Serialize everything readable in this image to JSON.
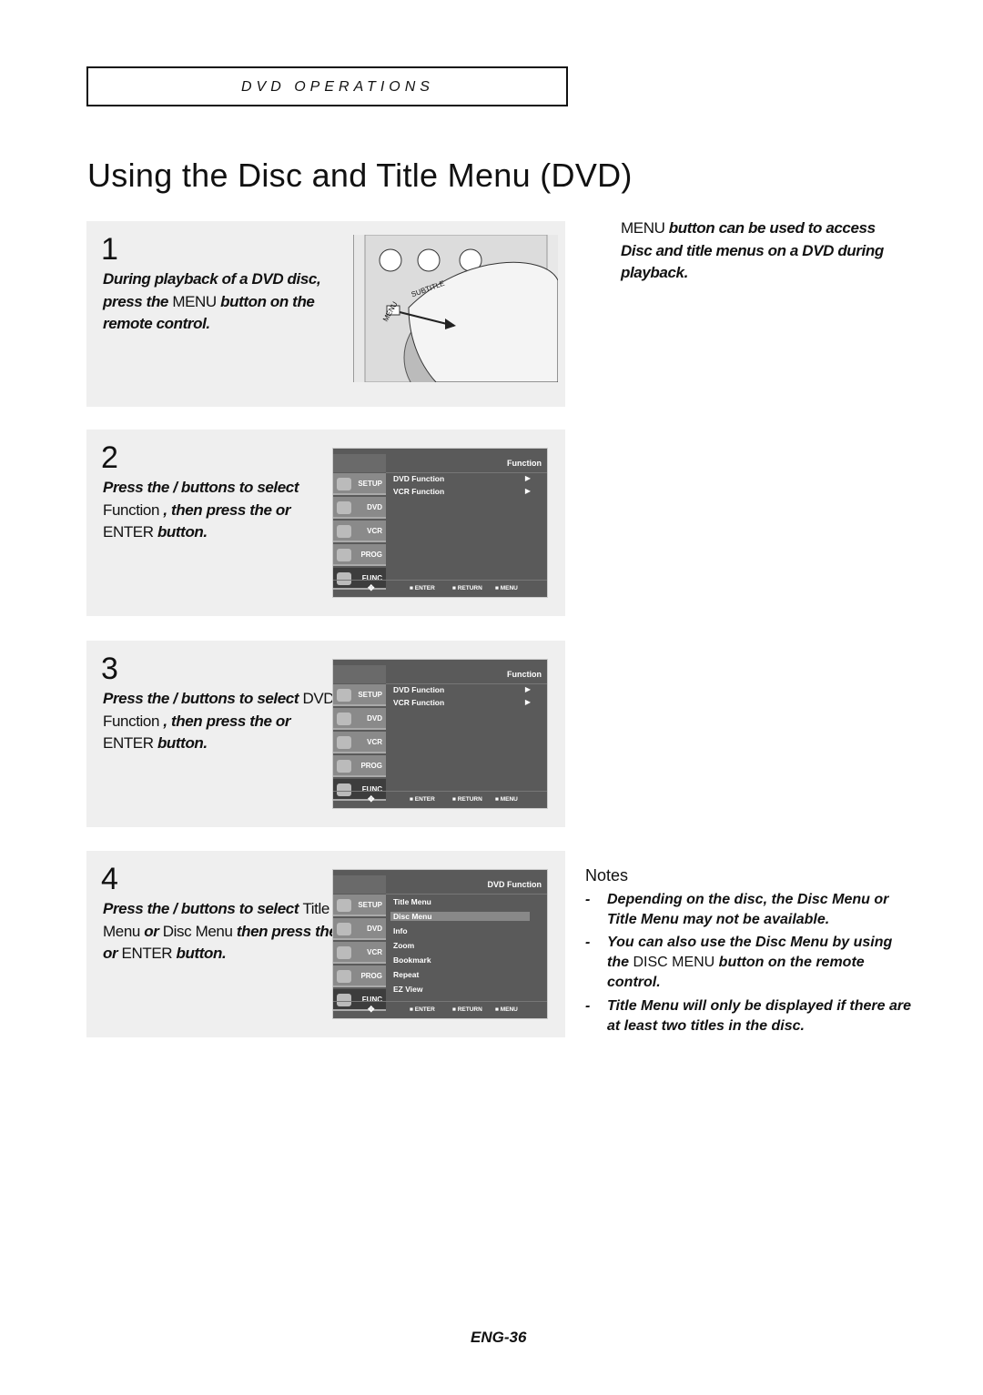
{
  "section": "DVD OPERATIONS",
  "title": "Using the Disc and Title Menu (DVD)",
  "intro": {
    "menu": "MENU",
    "rest1": " button can be used to access",
    "line2": "Disc and title menus on a DVD during",
    "line3": "playback."
  },
  "steps": [
    {
      "num": "1",
      "parts": [
        [
          "b",
          "During playback of a DVD disc, press the "
        ],
        [
          "n",
          "MENU"
        ],
        [
          "b",
          " button on the remote control."
        ]
      ]
    },
    {
      "num": "2",
      "parts": [
        [
          "b",
          "Press the    /    buttons to select "
        ],
        [
          "n",
          "Function"
        ],
        [
          "b",
          " , then press the     or "
        ],
        [
          "n",
          "ENTER"
        ],
        [
          "b",
          " button."
        ]
      ]
    },
    {
      "num": "3",
      "parts": [
        [
          "b",
          "Press the    /    buttons to select "
        ],
        [
          "n",
          "DVD Function"
        ],
        [
          "b",
          " , then press the     or "
        ],
        [
          "n",
          "ENTER"
        ],
        [
          "b",
          " button."
        ]
      ]
    },
    {
      "num": "4",
      "parts": [
        [
          "b",
          "Press the    /    buttons to select "
        ],
        [
          "n",
          "Title Menu"
        ],
        [
          "b",
          " or "
        ],
        [
          "n",
          "Disc Menu"
        ],
        [
          "b",
          " then press the     or "
        ],
        [
          "n",
          "ENTER"
        ],
        [
          "b",
          " button."
        ]
      ]
    }
  ],
  "remote": {
    "labels": [
      "SUBTITLE",
      "MENU"
    ]
  },
  "screens": [
    {
      "header": "Function",
      "items": [
        "DVD Function",
        "VCR Function"
      ],
      "arrows": true,
      "selected": -1
    },
    {
      "header": "Function",
      "items": [
        "DVD Function",
        "VCR Function"
      ],
      "arrows": true,
      "selected": -1
    },
    {
      "header": "DVD Function",
      "items": [
        "Title Menu",
        "Disc Menu",
        "Info",
        "Zoom",
        "Bookmark",
        "Repeat",
        "EZ View"
      ],
      "arrows": false,
      "selected": 1
    }
  ],
  "screen_side": [
    "SETUP",
    "DVD",
    "VCR",
    "PROG",
    "FUNC"
  ],
  "screen_foot": [
    "ENTER",
    "RETURN",
    "MENU"
  ],
  "notes": {
    "title": "Notes",
    "items": [
      [
        [
          "b",
          "Depending on the disc, the Disc Menu or Title Menu may not be available."
        ]
      ],
      [
        [
          "b",
          "You can also use the Disc Menu by using the "
        ],
        [
          "n",
          "DISC MENU"
        ],
        [
          "b",
          " button on the remote control."
        ]
      ],
      [
        [
          "b",
          "Title Menu will only be displayed if there are at least two titles in the disc."
        ]
      ]
    ]
  },
  "footer": "ENG-36"
}
